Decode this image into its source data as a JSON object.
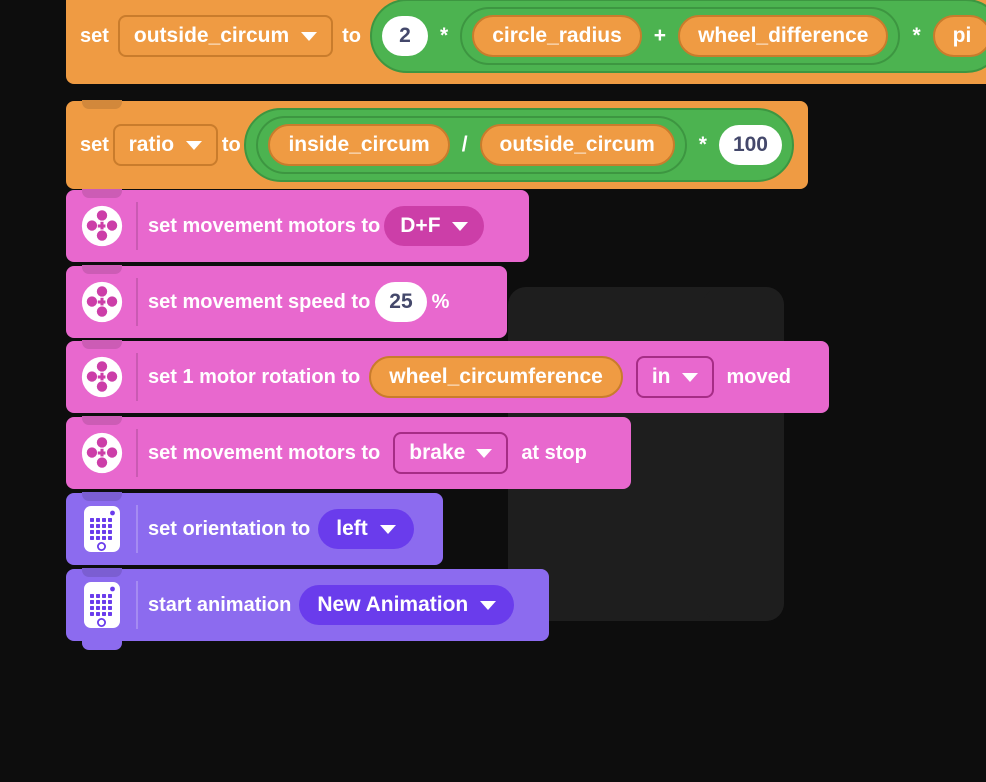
{
  "workspace": {
    "background_color": "#0d0d0d",
    "ghost_color": "#1e1e1e"
  },
  "palette": {
    "variable_orange": "#ef9b43",
    "operator_green": "#4cb350",
    "motor_pink": "#e868ce",
    "motor_pink_dark": "#cc3ea8",
    "display_purple": "#8c6bef",
    "display_purple_dark": "#6a3cec",
    "number_text": "#44486b"
  },
  "script": {
    "blocks": [
      {
        "id": "set-outside-circum",
        "category": "variable",
        "set_word": "set",
        "variable": "outside_circum",
        "to_word": "to",
        "expression": {
          "number": "2",
          "op1": "*",
          "inner_left": "circle_radius",
          "inner_op": "+",
          "inner_right": "wheel_difference",
          "op2": "*",
          "tail_variable": "pi"
        }
      },
      {
        "id": "set-ratio",
        "category": "variable",
        "set_word": "set",
        "variable": "ratio",
        "to_word": "to",
        "expression": {
          "left": "inside_circum",
          "op1": "/",
          "right": "outside_circum",
          "op2": "*",
          "number": "100"
        }
      },
      {
        "id": "set-movement-motors",
        "category": "motor",
        "icon": "motor-icon",
        "text": "set movement motors to",
        "dropdown": "D+F",
        "dropdown_style": "pill"
      },
      {
        "id": "set-movement-speed",
        "category": "motor",
        "icon": "motor-icon",
        "text": "set movement speed to",
        "value": "25",
        "suffix": "%"
      },
      {
        "id": "set-motor-rotation",
        "category": "motor",
        "icon": "motor-icon",
        "text": "set 1 motor rotation to",
        "reporter": "wheel_circumference",
        "dropdown": "in",
        "dropdown_style": "rect",
        "suffix": "moved"
      },
      {
        "id": "set-movement-motors-brake",
        "category": "motor",
        "icon": "motor-icon",
        "text": "set movement motors to",
        "dropdown": "brake",
        "dropdown_style": "rect",
        "suffix": "at stop"
      },
      {
        "id": "set-orientation",
        "category": "display",
        "icon": "hub-icon",
        "text": "set orientation to",
        "dropdown": "left",
        "dropdown_style": "pill"
      },
      {
        "id": "start-animation",
        "category": "display",
        "icon": "hub-icon",
        "text": "start animation",
        "dropdown": "New Animation",
        "dropdown_style": "pill"
      }
    ]
  }
}
